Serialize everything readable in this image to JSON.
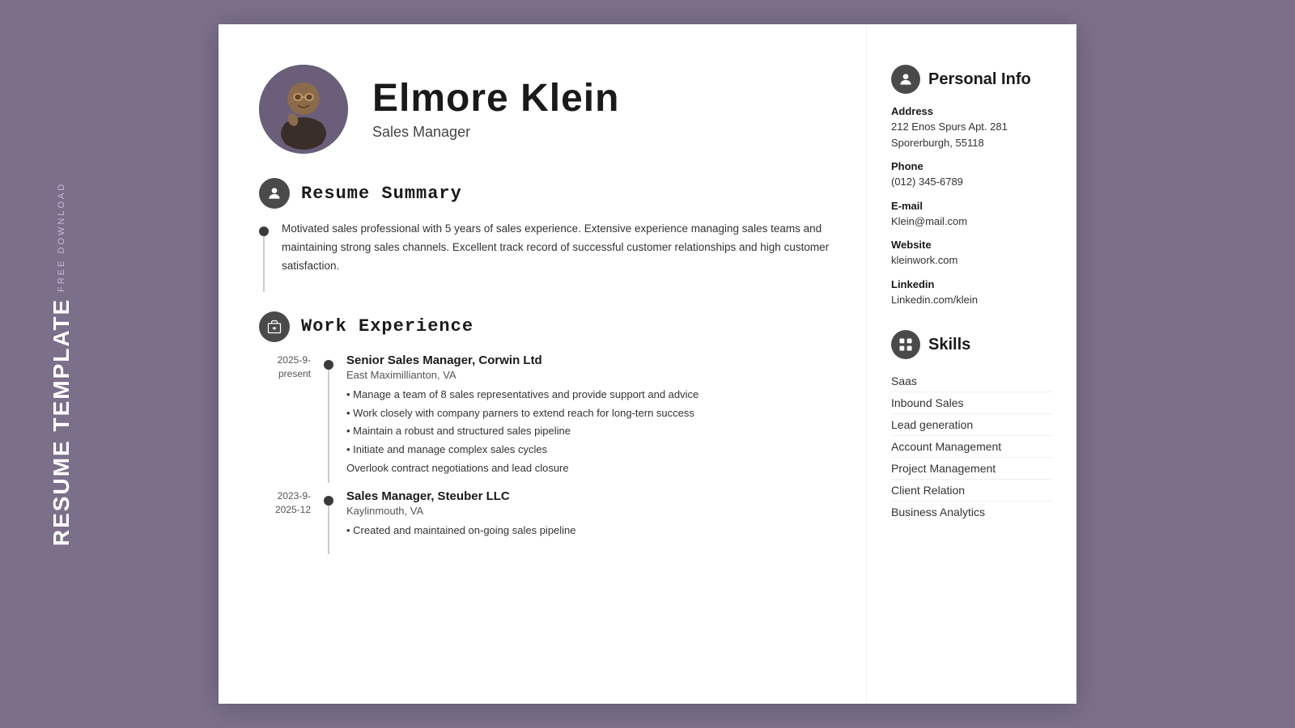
{
  "sideLabel": {
    "freeDownload": "FREE DOWNLOAD",
    "resumeTemplate": "RESUME TEMPLATE"
  },
  "header": {
    "name": "Elmore Klein",
    "title": "Sales Manager"
  },
  "sections": {
    "resumeSummary": {
      "label": "Resume Summary",
      "text": "Motivated sales professional with 5 years of sales experience. Extensive experience managing sales teams and maintaining strong sales channels. Excellent track record of successful customer relationships and high customer satisfaction."
    },
    "workExperience": {
      "label": "Work Experience",
      "jobs": [
        {
          "dateStart": "2025-9-",
          "dateEnd": "present",
          "title": "Senior Sales Manager, Corwin Ltd",
          "location": "East Maximillianton, VA",
          "bullets": [
            "• Manage a team of 8 sales representatives and provide support and advice",
            "• Work closely with company parners to extend reach for long-tern success",
            "• Maintain a robust and structured sales pipeline",
            "• Initiate and manage complex sales cycles",
            "Overlook contract negotiations and lead closure"
          ]
        },
        {
          "dateStart": "2023-9-",
          "dateEnd": "2025-12",
          "title": "Sales Manager, Steuber LLC",
          "location": "Kaylinmouth, VA",
          "bullets": [
            "• Created and maintained on-going sales pipeline"
          ]
        }
      ]
    }
  },
  "sidebar": {
    "personalInfo": {
      "label": "Personal Info",
      "address": {
        "label": "Address",
        "line1": "212 Enos Spurs Apt. 281",
        "line2": "Sporerburgh, 55118"
      },
      "phone": {
        "label": "Phone",
        "value": "(012) 345-6789"
      },
      "email": {
        "label": "E-mail",
        "value": "Klein@mail.com"
      },
      "website": {
        "label": "Website",
        "value": "kleinwork.com"
      },
      "linkedin": {
        "label": "Linkedin",
        "value": "Linkedin.com/klein"
      }
    },
    "skills": {
      "label": "Skills",
      "items": [
        "Saas",
        "Inbound Sales",
        "Lead generation",
        "Account Management",
        "Project Management",
        "Client Relation",
        "Business Analytics"
      ]
    }
  }
}
